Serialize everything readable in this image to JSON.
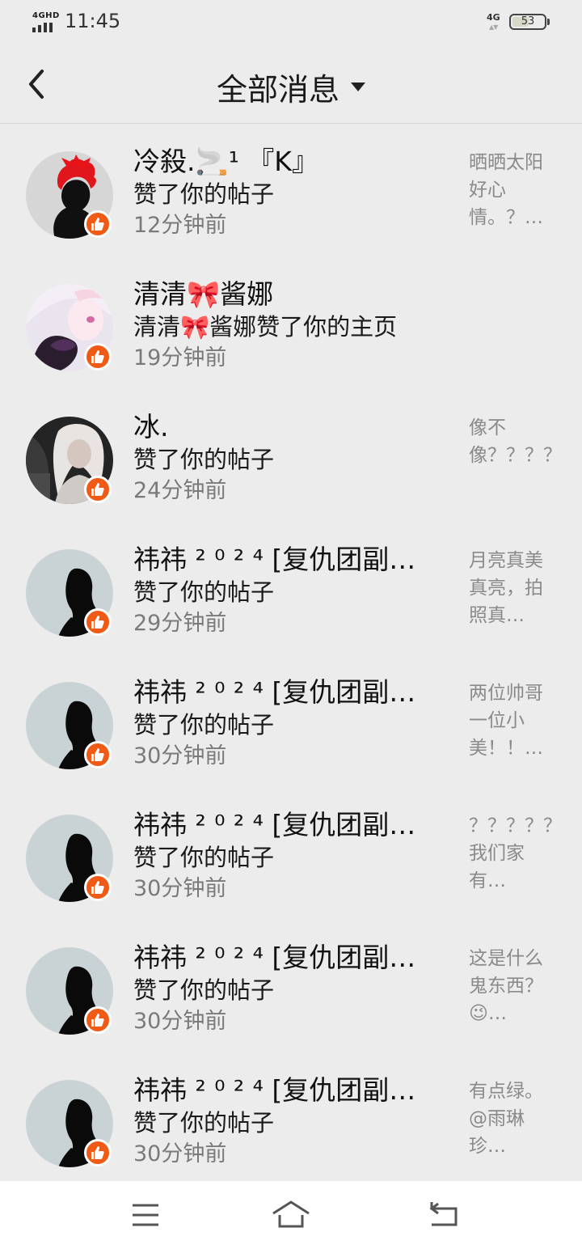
{
  "status_bar": {
    "network_type": "4GHD",
    "time": "11:45",
    "right_network": "4G",
    "battery_level": "53",
    "battery_fraction": 0.53
  },
  "header": {
    "title": "全部消息",
    "back_icon": "chevron-left-icon",
    "dropdown_icon": "caret-down-icon"
  },
  "notifications": [
    {
      "name": "冷殺.🚬¹ 『K』",
      "action": "赞了你的帖子",
      "time": "12分钟前",
      "preview": "晒晒太阳好心情。？…",
      "avatar": "red-hair-avatar"
    },
    {
      "name": "清清🎀酱娜",
      "action": "清清🎀酱娜赞了你的主页",
      "time": "19分钟前",
      "preview": "",
      "avatar": "anime-girl-avatar"
    },
    {
      "name": "冰.",
      "action": "赞了你的帖子",
      "time": "24分钟前",
      "preview": "像不像？？？？？？？…",
      "avatar": "photo-girl-avatar"
    },
    {
      "name": "祎祎 ² ⁰ ² ⁴ [复仇团副…",
      "action": "赞了你的帖子",
      "time": "29分钟前",
      "preview": "月亮真美真亮，拍照真…",
      "avatar": "default-female-avatar"
    },
    {
      "name": "祎祎 ² ⁰ ² ⁴ [复仇团副…",
      "action": "赞了你的帖子",
      "time": "30分钟前",
      "preview": "两位帅哥一位小美！！…",
      "avatar": "default-female-avatar"
    },
    {
      "name": "祎祎 ² ⁰ ² ⁴ [复仇团副…",
      "action": "赞了你的帖子",
      "time": "30分钟前",
      "preview": "？？？？？，我们家有…",
      "avatar": "default-female-avatar"
    },
    {
      "name": "祎祎 ² ⁰ ² ⁴ [复仇团副…",
      "action": "赞了你的帖子",
      "time": "30分钟前",
      "preview": "这是什么鬼东西？😉…",
      "avatar": "default-female-avatar"
    },
    {
      "name": "祎祎 ² ⁰ ² ⁴ [复仇团副…",
      "action": "赞了你的帖子",
      "time": "30分钟前",
      "preview": "有点绿。@雨琳珍…",
      "avatar": "default-female-avatar"
    }
  ],
  "nav_bar": {
    "icons": [
      "menu-icon",
      "home-icon",
      "back-icon"
    ]
  },
  "colors": {
    "background": "#ececec",
    "like_badge": "#f05a14",
    "default_avatar_bg": "#c9d3d6"
  }
}
